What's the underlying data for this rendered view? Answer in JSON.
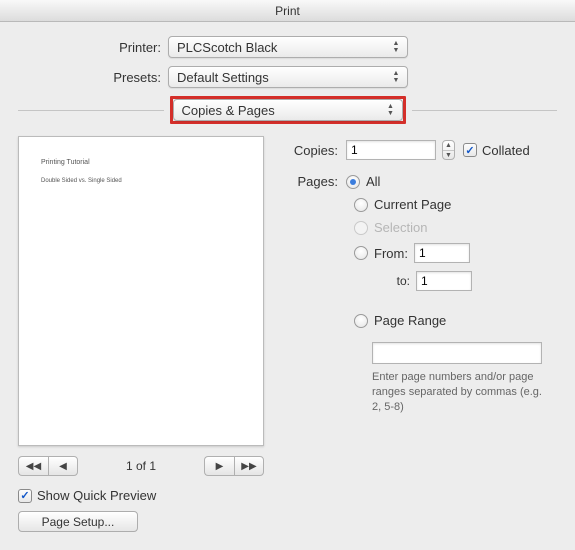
{
  "window": {
    "title": "Print"
  },
  "form": {
    "printer": {
      "label": "Printer:",
      "value": "PLCScotch Black"
    },
    "presets": {
      "label": "Presets:",
      "value": "Default Settings"
    },
    "section": {
      "value": "Copies & Pages"
    }
  },
  "preview": {
    "doc": {
      "title": "Printing Tutorial",
      "subtitle": "Double Sided vs. Single Sided"
    },
    "nav": {
      "first": "◀◀",
      "prev": "◀",
      "next": "▶",
      "last": "▶▶",
      "position": "1 of 1"
    },
    "quick": {
      "checked": "✓",
      "label": "Show Quick Preview"
    },
    "pagesetup": {
      "label": "Page Setup..."
    }
  },
  "copies": {
    "label": "Copies:",
    "value": "1",
    "collated": {
      "checked": "✓",
      "label": "Collated"
    }
  },
  "pages": {
    "label": "Pages:",
    "all": "All",
    "current": "Current Page",
    "selection": "Selection",
    "from_lbl": "From:",
    "from_val": "1",
    "to_lbl": "to:",
    "to_val": "1",
    "range_lbl": "Page Range",
    "range_val": "",
    "range_help": "Enter page numbers and/or page ranges separated by commas (e.g. 2, 5-8)"
  }
}
